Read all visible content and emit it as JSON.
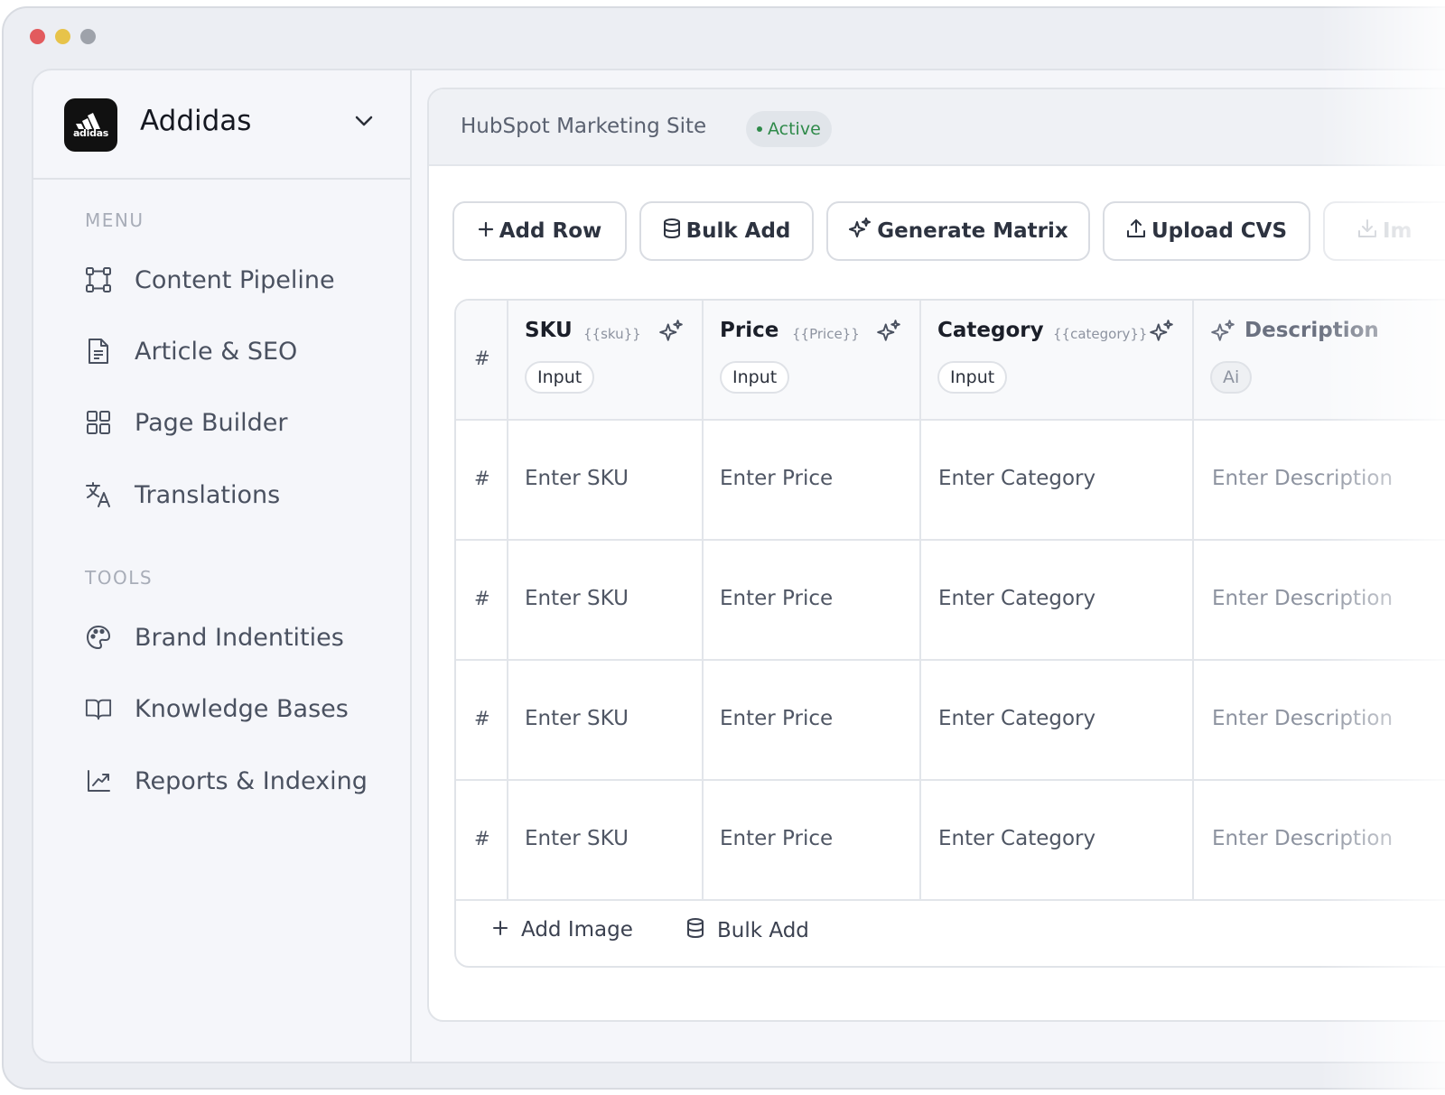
{
  "brand": {
    "name": "Addidas",
    "logo_text": "adidas"
  },
  "sidebar": {
    "menu_label": "MENU",
    "menu_items": [
      {
        "label": "Content Pipeline",
        "icon": "workflow-icon"
      },
      {
        "label": "Article & SEO",
        "icon": "document-icon"
      },
      {
        "label": "Page Builder",
        "icon": "grid-icon"
      },
      {
        "label": "Translations",
        "icon": "translate-icon"
      }
    ],
    "tools_label": "TOOLS",
    "tool_items": [
      {
        "label": "Brand Indentities",
        "icon": "palette-icon"
      },
      {
        "label": "Knowledge Bases",
        "icon": "book-icon"
      },
      {
        "label": "Reports & Indexing",
        "icon": "chart-up-icon"
      }
    ]
  },
  "header": {
    "site_title": "HubSpot Marketing Site",
    "status": "Active"
  },
  "toolbar": {
    "add_row": "Add Row",
    "bulk_add": "Bulk Add",
    "generate_matrix": "Generate Matrix",
    "upload_cvs": "Upload CVS",
    "import_partial": "Im"
  },
  "table": {
    "row_hash": "#",
    "columns": [
      {
        "title": "SKU",
        "var": "{{sku}}",
        "tag": "Input",
        "placeholder": "Enter SKU"
      },
      {
        "title": "Price",
        "var": "{{Price}}",
        "tag": "Input",
        "placeholder": "Enter Price"
      },
      {
        "title": "Category",
        "var": "{{category}}",
        "tag": "Input",
        "placeholder": "Enter Category"
      },
      {
        "title": "Description",
        "var": "",
        "tag": "Ai",
        "placeholder": "Enter Description"
      }
    ],
    "footer": {
      "add_image": "Add Image",
      "bulk_add": "Bulk Add"
    }
  },
  "colors": {
    "status_green": "#2f8a4a",
    "sidebar_bg": "#f5f6fa",
    "border": "#e0e3e8"
  }
}
